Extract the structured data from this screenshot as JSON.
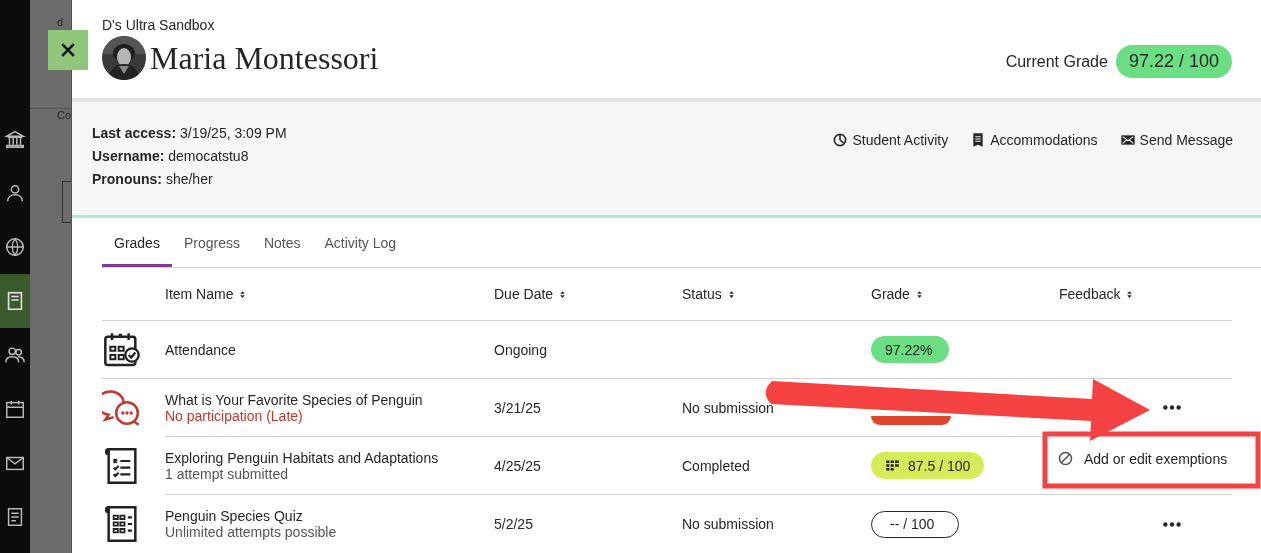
{
  "backdrop": {
    "texts": [
      "d",
      "Co"
    ],
    "nav": [
      {
        "kind": "institution",
        "selected": false
      },
      {
        "kind": "person",
        "selected": false
      },
      {
        "kind": "globe",
        "selected": false
      },
      {
        "kind": "book",
        "selected": true
      },
      {
        "kind": "people",
        "selected": false
      },
      {
        "kind": "calendar",
        "selected": false
      },
      {
        "kind": "mail",
        "selected": false
      },
      {
        "kind": "document",
        "selected": false
      }
    ]
  },
  "header": {
    "course": "D's Ultra Sandbox",
    "student": "Maria Montessori",
    "current_grade": {
      "label": "Current Grade",
      "value": "97.22 / 100",
      "color": "#6bdd82"
    }
  },
  "info": {
    "fields": [
      {
        "label": "Last access:",
        "value": "3/19/25, 3:09 PM"
      },
      {
        "label": "Username:",
        "value": "democatstu8"
      },
      {
        "label": "Pronouns:",
        "value": "she/her"
      }
    ],
    "actions": [
      {
        "kind": "activity",
        "label": "Student Activity"
      },
      {
        "kind": "accommodations",
        "label": "Accommodations"
      },
      {
        "kind": "message",
        "label": "Send Message"
      }
    ]
  },
  "tabs": [
    {
      "label": "Grades",
      "selected": true
    },
    {
      "label": "Progress",
      "selected": false
    },
    {
      "label": "Notes",
      "selected": false
    },
    {
      "label": "Activity Log",
      "selected": false
    }
  ],
  "table": {
    "columns": [
      "Item Name",
      "Due Date",
      "Status",
      "Grade",
      "Feedback"
    ],
    "rows": [
      {
        "kind": "attendance",
        "name": "Attendance",
        "due": "Ongoing",
        "grade": {
          "kind": "plain",
          "text": "97.22%",
          "color": "#6bdd82"
        }
      },
      {
        "kind": "discussion",
        "name": "What is Your Favorite Species of Penguin",
        "detail": "No participation (Late)",
        "late": true,
        "due": "3/21/25",
        "status": "No submission",
        "grade": {
          "kind": "hidden",
          "color": "#e0452e"
        },
        "more_actions": true
      },
      {
        "kind": "assignment",
        "name": "Exploring Penguin Habitats and Adaptations",
        "detail": "1 attempt submitted",
        "late": false,
        "due": "4/25/25",
        "status": "Completed",
        "grade": {
          "kind": "calculated",
          "text": "87.5 / 100",
          "color": "#d6ea5a"
        }
      },
      {
        "kind": "quiz",
        "name": "Penguin Species Quiz",
        "detail": "Unlimited attempts possible",
        "late": false,
        "due": "5/2/25",
        "status": "No submission",
        "grade": {
          "kind": "outline",
          "text": "-- / 100",
          "color": "#ffffff"
        },
        "more_actions": true
      }
    ]
  },
  "menu": {
    "items": [
      {
        "kind": "exempt",
        "label": "Add or edit exemptions"
      }
    ]
  },
  "annotations": {
    "arrow": {
      "color": "#f44242"
    },
    "highlight": {
      "color": "#f44242"
    }
  }
}
